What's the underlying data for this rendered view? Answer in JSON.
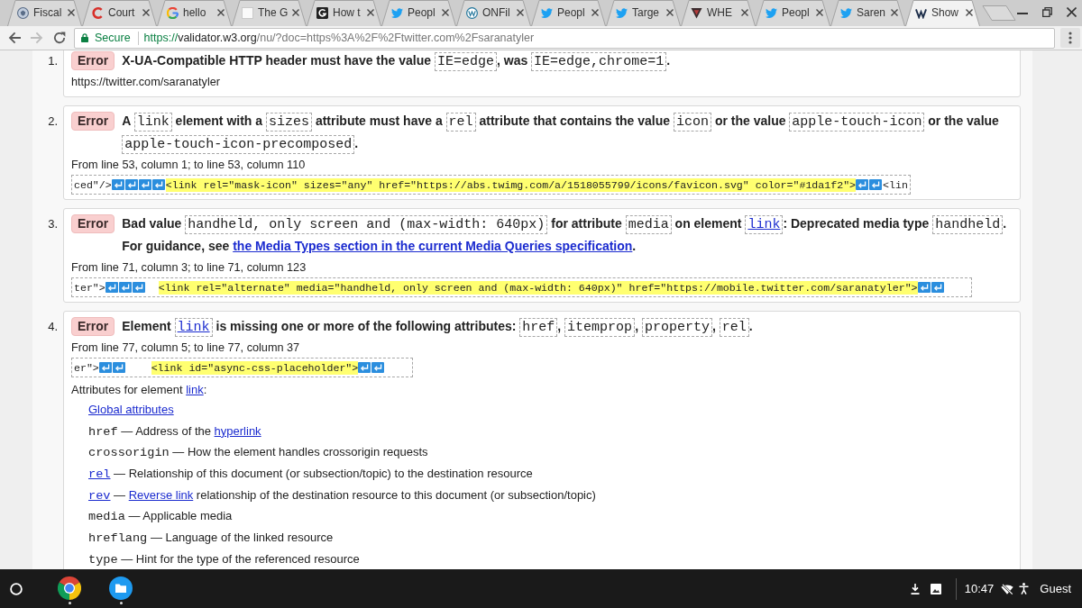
{
  "browser": {
    "tabs": [
      {
        "title": "Fiscal",
        "kind": "seal",
        "selected": false
      },
      {
        "title": "Court",
        "kind": "arc",
        "selected": false
      },
      {
        "title": "hello",
        "kind": "gcolor",
        "selected": false
      },
      {
        "title": "The G",
        "kind": "page",
        "selected": false
      },
      {
        "title": "How t",
        "kind": "gtile",
        "selected": false
      },
      {
        "title": "Peopl",
        "kind": "bird",
        "selected": false
      },
      {
        "title": "ONFil",
        "kind": "wcircle",
        "selected": false
      },
      {
        "title": "Peopl",
        "kind": "bird",
        "selected": false
      },
      {
        "title": "Targe",
        "kind": "bird",
        "selected": false
      },
      {
        "title": "WHE",
        "kind": "shield",
        "selected": false
      },
      {
        "title": "Peopl",
        "kind": "bird",
        "selected": false
      },
      {
        "title": "Saren",
        "kind": "bird",
        "selected": false
      },
      {
        "title": "Show",
        "kind": "wmark",
        "selected": true
      }
    ],
    "toolbar": {
      "security": "Secure",
      "url": {
        "scheme": "https://",
        "host": "validator.w3.org",
        "path": "/nu/?doc=https%3A%2F%2Ftwitter.com%2Fsaranatyler"
      }
    }
  },
  "results": [
    {
      "number": "1.",
      "badge": "Error",
      "message": [
        {
          "kind": "text",
          "text": "X-UA-Compatible HTTP header must have the value "
        },
        {
          "kind": "code",
          "text": "IE=edge"
        },
        {
          "kind": "text",
          "text": ", was "
        },
        {
          "kind": "code",
          "text": "IE=edge,chrome=1"
        },
        {
          "kind": "text",
          "text": "."
        }
      ],
      "location": "https://twitter.com/saranatyler"
    },
    {
      "number": "2.",
      "badge": "Error",
      "message": [
        {
          "kind": "text",
          "text": "A "
        },
        {
          "kind": "code",
          "text": "link"
        },
        {
          "kind": "text",
          "text": " element with a "
        },
        {
          "kind": "code",
          "text": "sizes"
        },
        {
          "kind": "text",
          "text": " attribute must have a "
        },
        {
          "kind": "code",
          "text": "rel"
        },
        {
          "kind": "text",
          "text": " attribute that contains the value "
        },
        {
          "kind": "code",
          "text": "icon"
        },
        {
          "kind": "text",
          "text": " or the value "
        },
        {
          "kind": "code",
          "text": "apple-touch-icon"
        },
        {
          "kind": "text",
          "text": " or the value "
        },
        {
          "kind": "code",
          "text": "apple-touch-icon-precomposed"
        },
        {
          "kind": "text",
          "text": "."
        }
      ],
      "location": "From line 53, column 1; to line 53, column 110",
      "extract": [
        {
          "kind": "text",
          "text": "ced\"/>"
        },
        {
          "kind": "newline"
        },
        {
          "kind": "newline"
        },
        {
          "kind": "newline"
        },
        {
          "kind": "newline"
        },
        {
          "kind": "highlight",
          "text": "<link rel=\"mask-icon\" sizes=\"any\" href=\"https://abs.twimg.com/a/1518055799/icons/favicon.svg\" color=\"#1da1f2\">"
        },
        {
          "kind": "newline"
        },
        {
          "kind": "newline"
        },
        {
          "kind": "text",
          "text": "<lin"
        }
      ]
    },
    {
      "number": "3.",
      "badge": "Error",
      "message": [
        {
          "kind": "text",
          "text": "Bad value "
        },
        {
          "kind": "code",
          "text": "handheld, only screen and (max-width: 640px)"
        },
        {
          "kind": "text",
          "text": " for attribute "
        },
        {
          "kind": "code",
          "text": "media"
        },
        {
          "kind": "text",
          "text": " on element "
        },
        {
          "kind": "code_link",
          "text": "link"
        },
        {
          "kind": "text",
          "text": ": Deprecated media type "
        },
        {
          "kind": "code",
          "text": "handheld"
        },
        {
          "kind": "text",
          "text": ". For guidance, see "
        },
        {
          "kind": "link",
          "text": "the Media Types section in the current Media Queries specification"
        },
        {
          "kind": "text",
          "text": "."
        }
      ],
      "location": "From line 71, column 3; to line 71, column 123",
      "extract": [
        {
          "kind": "text",
          "text": "ter\">"
        },
        {
          "kind": "newline"
        },
        {
          "kind": "newline"
        },
        {
          "kind": "newline"
        },
        {
          "kind": "space"
        },
        {
          "kind": "space"
        },
        {
          "kind": "highlight",
          "text": "<link rel=\"alternate\" media=\"handheld, only screen and (max-width: 640px)\" href=\"https://mobile.twitter.com/saranatyler\">"
        },
        {
          "kind": "newline"
        },
        {
          "kind": "newline"
        },
        {
          "kind": "space"
        },
        {
          "kind": "space"
        },
        {
          "kind": "space"
        },
        {
          "kind": "space"
        }
      ]
    },
    {
      "number": "4.",
      "badge": "Error",
      "message": [
        {
          "kind": "text",
          "text": "Element "
        },
        {
          "kind": "code_link",
          "text": "link"
        },
        {
          "kind": "text",
          "text": " is missing one or more of the following attributes: "
        },
        {
          "kind": "code",
          "text": "href"
        },
        {
          "kind": "text",
          "text": ", "
        },
        {
          "kind": "code",
          "text": "itemprop"
        },
        {
          "kind": "text",
          "text": ", "
        },
        {
          "kind": "code",
          "text": "property"
        },
        {
          "kind": "text",
          "text": ", "
        },
        {
          "kind": "code",
          "text": "rel"
        },
        {
          "kind": "text",
          "text": "."
        }
      ],
      "location": "From line 77, column 5; to line 77, column 37",
      "extract": [
        {
          "kind": "text",
          "text": "er\">"
        },
        {
          "kind": "newline"
        },
        {
          "kind": "newline"
        },
        {
          "kind": "space"
        },
        {
          "kind": "space"
        },
        {
          "kind": "space"
        },
        {
          "kind": "space"
        },
        {
          "kind": "highlight",
          "text": "<link id=\"async-css-placeholder\">"
        },
        {
          "kind": "newline"
        },
        {
          "kind": "newline"
        },
        {
          "kind": "space"
        },
        {
          "kind": "space"
        },
        {
          "kind": "space"
        },
        {
          "kind": "space"
        }
      ],
      "attributes_heading": [
        {
          "kind": "text",
          "text": "Attributes for element "
        },
        {
          "kind": "link",
          "text": "link"
        },
        {
          "kind": "text",
          "text": ":"
        }
      ],
      "attributes": [
        {
          "kind": "link",
          "text": "Global attributes"
        },
        {
          "kind": "entry",
          "parts": [
            {
              "kind": "attr",
              "text": "href"
            },
            {
              "kind": "text",
              "text": " — Address of the "
            },
            {
              "kind": "link",
              "text": "hyperlink"
            }
          ]
        },
        {
          "kind": "entry",
          "parts": [
            {
              "kind": "attr",
              "text": "crossorigin"
            },
            {
              "kind": "text",
              "text": " — How the element handles crossorigin requests"
            }
          ]
        },
        {
          "kind": "entry",
          "parts": [
            {
              "kind": "attr_link",
              "text": "rel"
            },
            {
              "kind": "text",
              "text": " — Relationship of this document (or subsection/topic) to the destination resource"
            }
          ]
        },
        {
          "kind": "entry",
          "parts": [
            {
              "kind": "attr_link",
              "text": "rev"
            },
            {
              "kind": "text",
              "text": " — "
            },
            {
              "kind": "link",
              "text": "Reverse link"
            },
            {
              "kind": "text",
              "text": " relationship of the destination resource to this document (or subsection/topic)"
            }
          ]
        },
        {
          "kind": "entry",
          "parts": [
            {
              "kind": "attr",
              "text": "media"
            },
            {
              "kind": "text",
              "text": " — Applicable media"
            }
          ]
        },
        {
          "kind": "entry",
          "parts": [
            {
              "kind": "attr",
              "text": "hreflang"
            },
            {
              "kind": "text",
              "text": " — Language of the linked resource"
            }
          ]
        },
        {
          "kind": "entry",
          "parts": [
            {
              "kind": "attr",
              "text": "type"
            },
            {
              "kind": "text",
              "text": " — Hint for the type of the referenced resource"
            }
          ]
        }
      ]
    }
  ],
  "taskbar": {
    "time": "10:47",
    "user": "Guest"
  }
}
